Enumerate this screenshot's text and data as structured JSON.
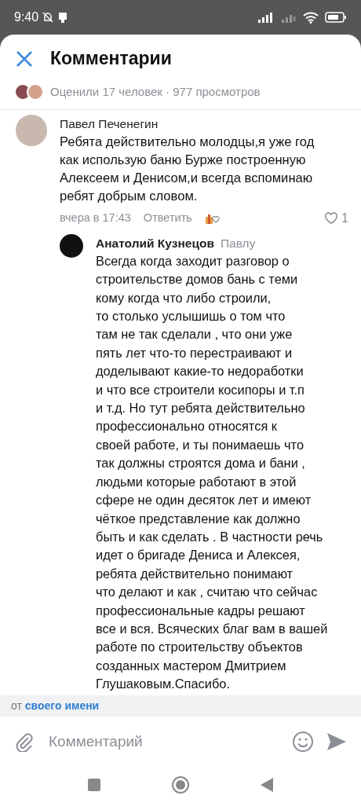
{
  "status_bar": {
    "time": "9:40"
  },
  "header": {
    "title": "Комментарии"
  },
  "stats": {
    "text": "Оценили 17 человек · 977 просмотров"
  },
  "comments": [
    {
      "author": "Павел Печенегин",
      "text": "Ребята действительно молодцы,я уже год\nкак использую баню Бурже построенную\nАлексеем и Денисом,и всегда вспоминаю\nребят добрым словом.",
      "time": "вчера в 17:43",
      "reply_label": "Ответить",
      "likes": "1",
      "liked": false,
      "replies": [
        {
          "author": "Анатолий Кузнецов",
          "reply_to": "Павлу",
          "text": "Всегда когда заходит разговор о\nстроительстве домов бань с теми\nкому когда что либо строили,\nто столько услышишь о том что\nтам не так сделали , что они уже\nпять лет что-то перестраивают и\nдоделывают какие-то недоработки\nи что все строители косипоры и т.п\nи т.д. Но тут ребята действительно\nпрофессионально относятся к\nсвоей работе, и ты понимаешь что\nтак должны строятся дома и бани ,\nлюдьми которые работают в этой\nсфере не один десяток лет и имеют\nчёткое представление как должно\nбыть и как сделать . В частности речь\nидет о бригаде Дениса и Алексея,\nребята действительно понимают\nчто делают и как , считаю что сейчас\nпрофессиональные кадры решают\nвсе и вся. Всяческих благ вам в вашей\nработе по строительству объектов\nсозданных мастером Дмитрием\nГлушаковым.Спасибо."
        }
      ]
    }
  ],
  "author_bar": {
    "prefix": "от",
    "link": "своего имени"
  },
  "composer": {
    "placeholder": "Комментарий"
  }
}
